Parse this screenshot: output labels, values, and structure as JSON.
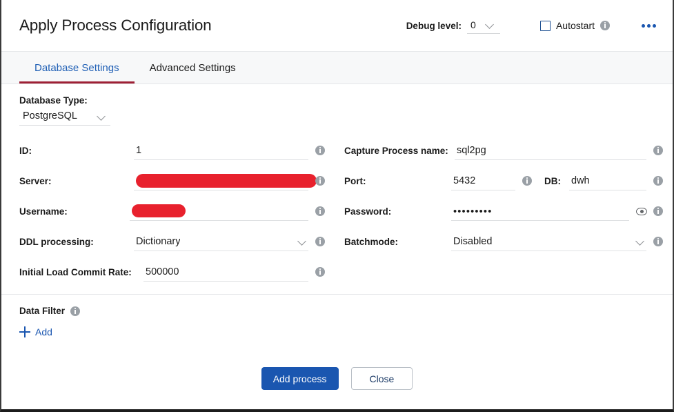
{
  "header": {
    "title": "Apply Process Configuration",
    "debug_label": "Debug level:",
    "debug_value": "0",
    "autostart_label": "Autostart",
    "autostart_checked": false,
    "overflow_menu": "more-options"
  },
  "tabs": [
    {
      "label": "Database Settings",
      "active": true
    },
    {
      "label": "Advanced Settings",
      "active": false
    }
  ],
  "form": {
    "database_type": {
      "label": "Database Type:",
      "value": "PostgreSQL"
    },
    "left": {
      "id": {
        "label": "ID:",
        "value": "1"
      },
      "server": {
        "label": "Server:",
        "value": "",
        "redacted": true
      },
      "username": {
        "label": "Username:",
        "value": "",
        "redacted": true
      },
      "ddl_processing": {
        "label": "DDL processing:",
        "value": "Dictionary"
      },
      "initial_load_commit_rate": {
        "label": "Initial Load Commit Rate:",
        "value": "500000"
      }
    },
    "right": {
      "capture_process_name": {
        "label": "Capture Process name:",
        "value": "sql2pg"
      },
      "port": {
        "label": "Port:",
        "value": "5432"
      },
      "db": {
        "label": "DB:",
        "value": "dwh"
      },
      "password": {
        "label": "Password:",
        "value": "•••••••••"
      },
      "batchmode": {
        "label": "Batchmode:",
        "value": "Disabled"
      }
    }
  },
  "data_filter": {
    "title": "Data Filter",
    "add_label": "Add"
  },
  "footer": {
    "primary_label": "Add process",
    "secondary_label": "Close"
  },
  "colors": {
    "accent_blue": "#1a56b0",
    "tab_active_text": "#1f5fb5",
    "tab_underline": "#9e2035",
    "redaction_red": "#e8212d",
    "tabbar_background": "#f7f8f9"
  }
}
